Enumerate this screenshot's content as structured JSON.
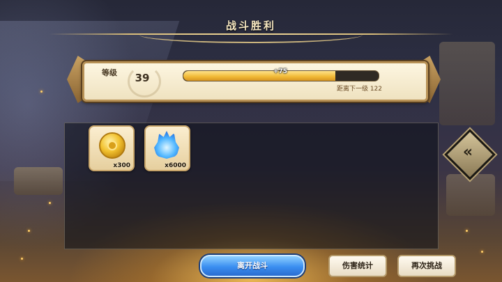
{
  "header": {
    "title": "战斗胜利"
  },
  "level": {
    "label": "等级",
    "value": "39",
    "xp_gain": "+75",
    "progress_fraction": 0.78,
    "next_level_text": "距离下一级 122"
  },
  "rewards": [
    {
      "icon": "gold-coin-icon",
      "count": "x300"
    },
    {
      "icon": "blue-flame-icon",
      "count": "x6000"
    }
  ],
  "side_nav": {
    "icon": "double-chevron-icon",
    "glyph": "«"
  },
  "buttons": {
    "leave": "离开战斗",
    "damage_stats": "伤害统计",
    "retry": "再次挑战"
  },
  "colors": {
    "xp_fill": "#f0b833",
    "primary_button": "#3a8ef0",
    "banner_border": "#b89257"
  }
}
